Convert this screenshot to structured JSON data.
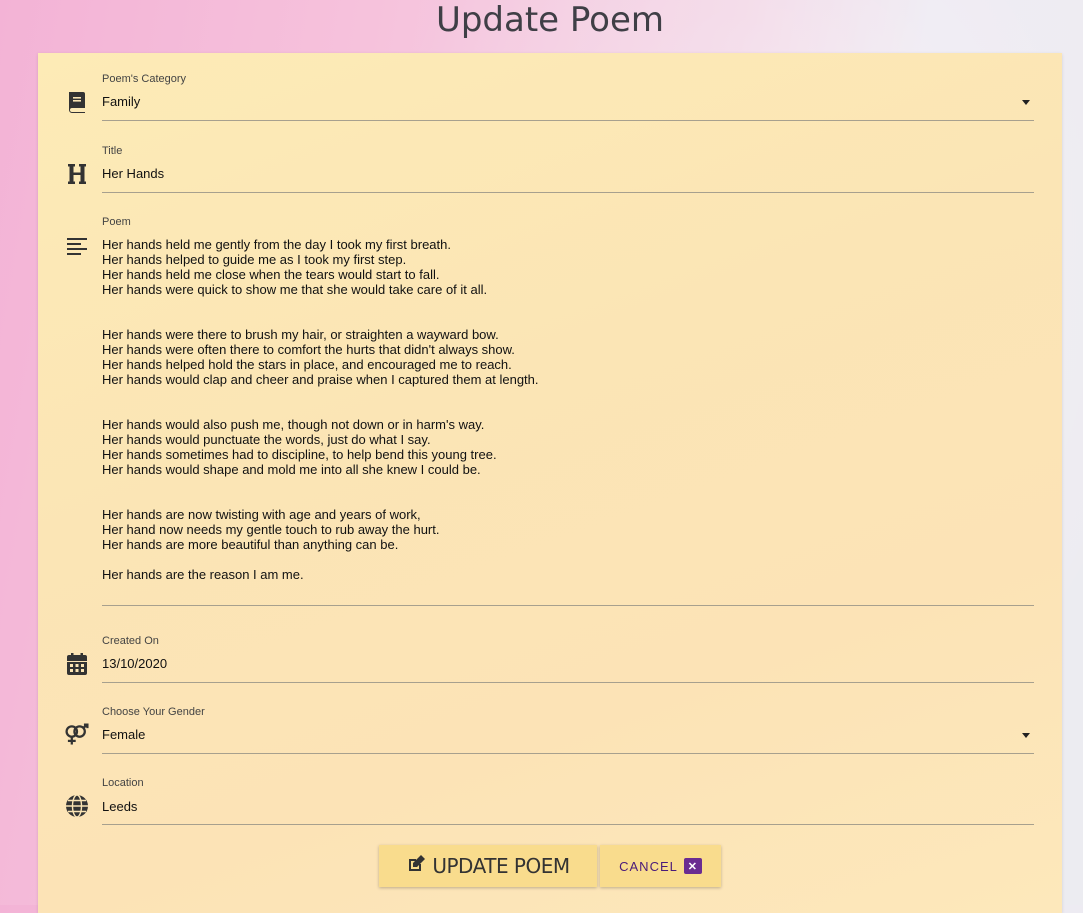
{
  "page": {
    "title": "Update Poem"
  },
  "form": {
    "category": {
      "label": "Poem's Category",
      "value": "Family",
      "icon": "book-icon"
    },
    "title": {
      "label": "Title",
      "value": "Her Hands",
      "icon": "heading-icon"
    },
    "poem": {
      "label": "Poem",
      "icon": "align-left-icon",
      "stanzas": [
        "Her hands held me gently from the day I took my first breath.\nHer hands helped to guide me as I took my first step.\nHer hands held me close when the tears would start to fall.\nHer hands were quick to show me that she would take care of it all.",
        "Her hands were there to brush my hair, or straighten a wayward bow.\nHer hands were often there to comfort the hurts that didn't always show.\nHer hands helped hold the stars in place, and encouraged me to reach.\nHer hands would clap and cheer and praise when I captured them at length.",
        "Her hands would also push me, though not down or in harm's way.\nHer hands would punctuate the words, just do what I say.\nHer hands sometimes had to discipline, to help bend this young tree.\nHer hands would shape and mold me into all she knew I could be.",
        "Her hands are now twisting with age and years of work,\nHer hand now needs my gentle touch to rub away the hurt.\nHer hands are more beautiful than anything can be.",
        "Her hands are the reason I am me."
      ]
    },
    "created": {
      "label": "Created On",
      "value": "13/10/2020",
      "icon": "calendar-icon"
    },
    "gender": {
      "label": "Choose Your Gender",
      "value": "Female",
      "icon": "venus-mars-icon"
    },
    "location": {
      "label": "Location",
      "value": "Leeds",
      "icon": "globe-icon"
    }
  },
  "buttons": {
    "update": {
      "label": "UPDATE POEM",
      "icon": "edit-icon"
    },
    "cancel": {
      "label": "CANCEL",
      "icon": "close-icon"
    }
  }
}
